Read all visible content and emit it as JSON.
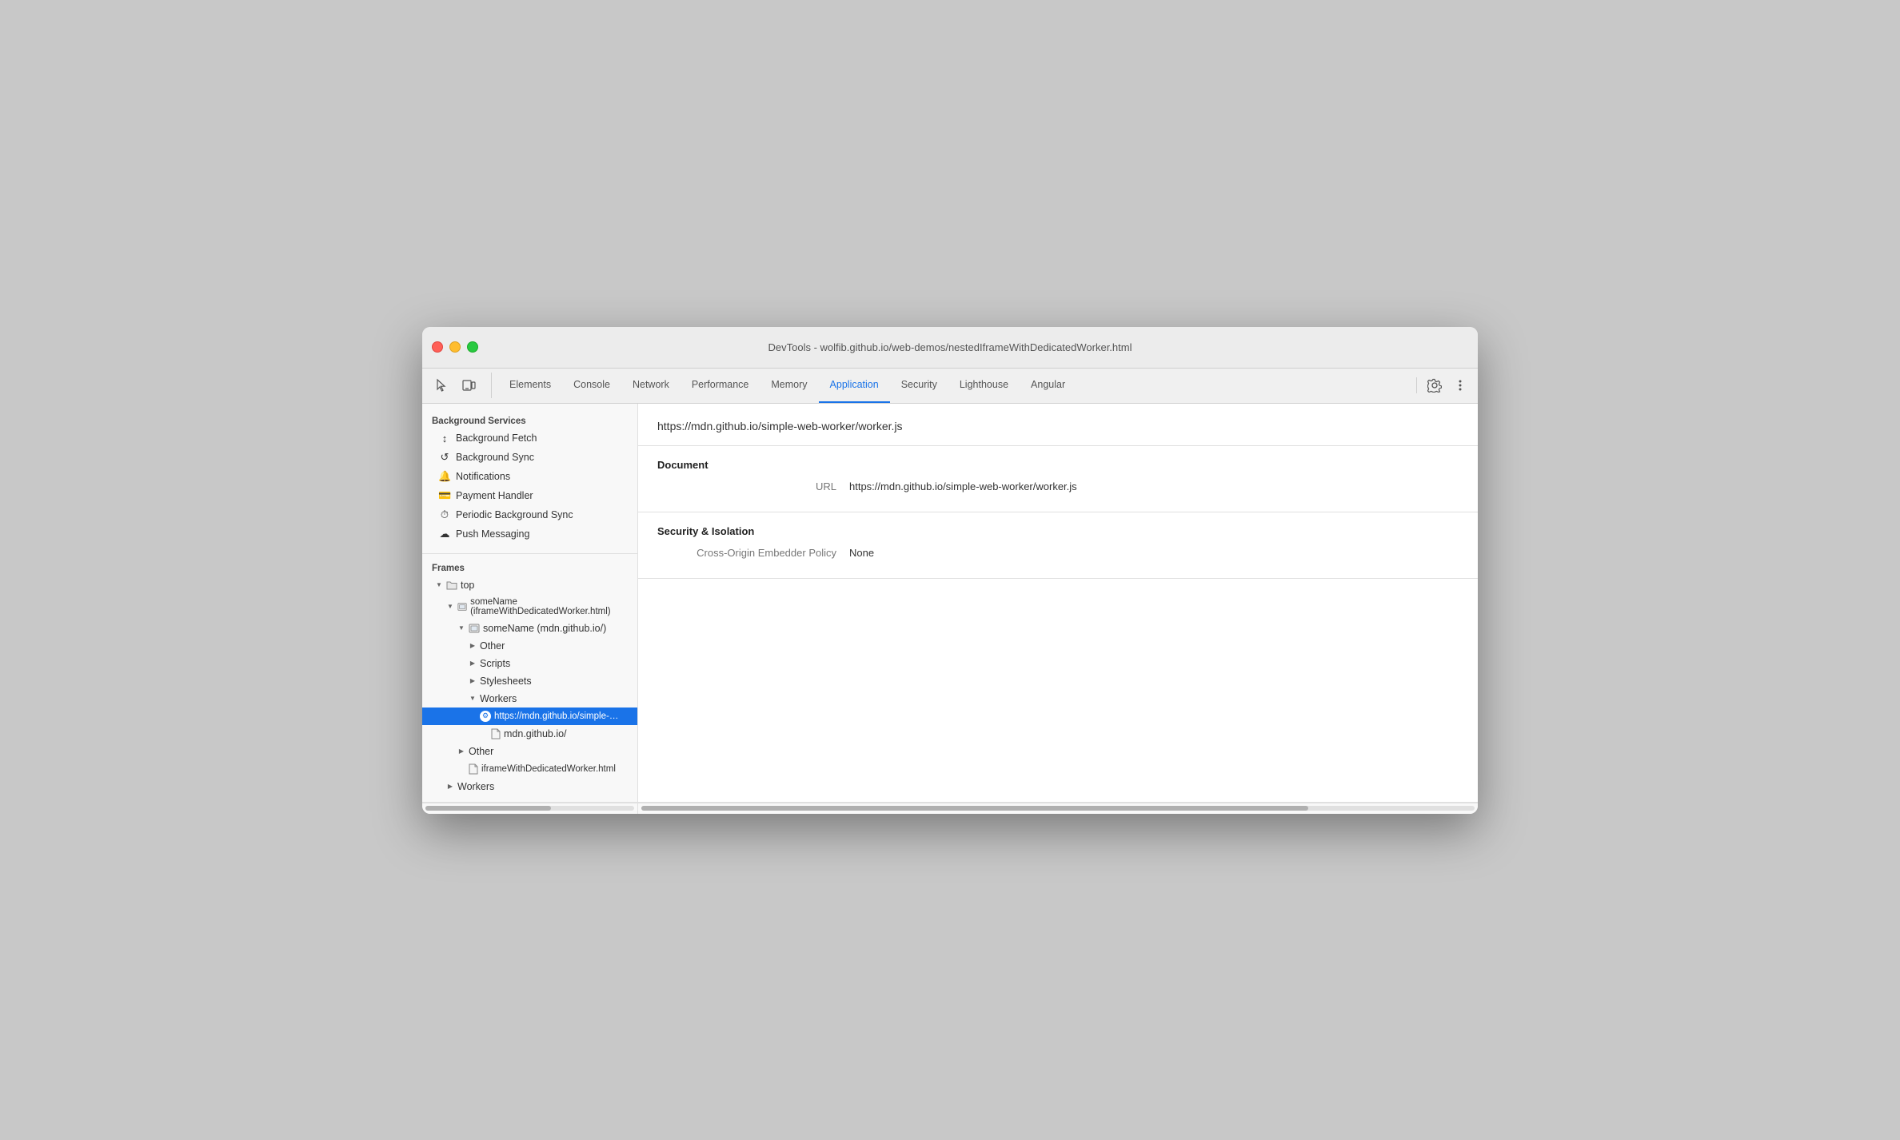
{
  "window": {
    "title": "DevTools - wolfib.github.io/web-demos/nestedIframeWithDedicatedWorker.html"
  },
  "toolbar": {
    "inspect_label": "Inspect",
    "device_label": "Device",
    "tabs": [
      {
        "id": "elements",
        "label": "Elements",
        "active": false
      },
      {
        "id": "console",
        "label": "Console",
        "active": false
      },
      {
        "id": "network",
        "label": "Network",
        "active": false
      },
      {
        "id": "performance",
        "label": "Performance",
        "active": false
      },
      {
        "id": "memory",
        "label": "Memory",
        "active": false
      },
      {
        "id": "application",
        "label": "Application",
        "active": true
      },
      {
        "id": "security",
        "label": "Security",
        "active": false
      },
      {
        "id": "lighthouse",
        "label": "Lighthouse",
        "active": false
      },
      {
        "id": "angular",
        "label": "Angular",
        "active": false
      }
    ],
    "settings_label": "Settings",
    "more_label": "More"
  },
  "sidebar": {
    "background_services_title": "Background Services",
    "items": [
      {
        "id": "background-fetch",
        "label": "Background Fetch",
        "icon": "↕"
      },
      {
        "id": "background-sync",
        "label": "Background Sync",
        "icon": "↺"
      },
      {
        "id": "notifications",
        "label": "Notifications",
        "icon": "🔔"
      },
      {
        "id": "payment-handler",
        "label": "Payment Handler",
        "icon": "💳"
      },
      {
        "id": "periodic-background-sync",
        "label": "Periodic Background Sync",
        "icon": "⏱"
      },
      {
        "id": "push-messaging",
        "label": "Push Messaging",
        "icon": "☁"
      }
    ],
    "frames_title": "Frames",
    "tree": [
      {
        "id": "top",
        "label": "top",
        "indent": 1,
        "type": "folder",
        "open": true
      },
      {
        "id": "some-name-iframe",
        "label": "someName (iframeWithDedicatedWorker.html)",
        "indent": 2,
        "type": "folder",
        "open": true
      },
      {
        "id": "some-name-mdn",
        "label": "someName (mdn.github.io/)",
        "indent": 3,
        "type": "folder",
        "open": true
      },
      {
        "id": "other-1",
        "label": "Other",
        "indent": 4,
        "type": "folder-closed"
      },
      {
        "id": "scripts",
        "label": "Scripts",
        "indent": 4,
        "type": "folder-closed"
      },
      {
        "id": "stylesheets",
        "label": "Stylesheets",
        "indent": 4,
        "type": "folder-closed"
      },
      {
        "id": "workers",
        "label": "Workers",
        "indent": 4,
        "type": "folder",
        "open": true
      },
      {
        "id": "worker-url",
        "label": "https://mdn.github.io/simple-web-worker",
        "indent": 5,
        "type": "worker",
        "selected": true
      },
      {
        "id": "mdn-github",
        "label": "mdn.github.io/",
        "indent": 5,
        "type": "file"
      },
      {
        "id": "other-2",
        "label": "Other",
        "indent": 3,
        "type": "folder-closed"
      },
      {
        "id": "iframe-file",
        "label": "iframeWithDedicatedWorker.html",
        "indent": 3,
        "type": "file"
      },
      {
        "id": "workers-top",
        "label": "Workers",
        "indent": 2,
        "type": "folder-closed"
      }
    ]
  },
  "detail": {
    "url": "https://mdn.github.io/simple-web-worker/worker.js",
    "document_section": "Document",
    "url_label": "URL",
    "url_value": "https://mdn.github.io/simple-web-worker/worker.js",
    "security_section": "Security & Isolation",
    "coep_label": "Cross-Origin Embedder Policy",
    "coep_value": "None"
  }
}
